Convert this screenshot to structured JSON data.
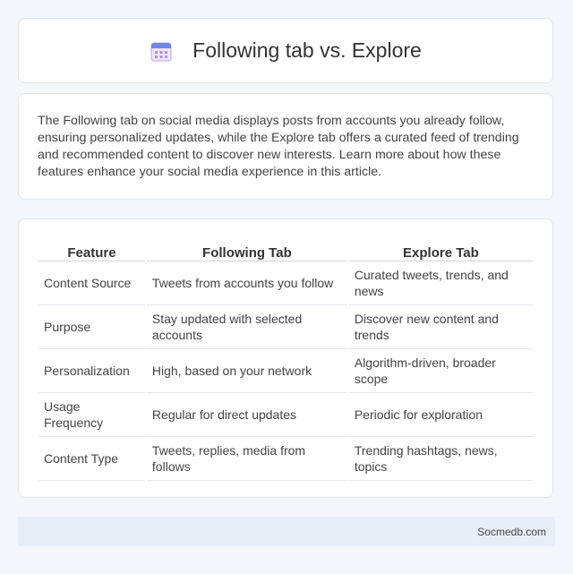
{
  "header": {
    "title": "Following tab vs. Explore",
    "icon": "calendar-icon"
  },
  "intro": {
    "text": "The Following tab on social media displays posts from accounts you already follow, ensuring personalized updates, while the Explore tab offers a curated feed of trending and recommended content to discover new interests. Learn more about how these features enhance your social media experience in this article."
  },
  "table": {
    "headers": [
      "Feature",
      "Following Tab",
      "Explore Tab"
    ],
    "rows": [
      [
        "Content Source",
        "Tweets from accounts you follow",
        "Curated tweets, trends, and news"
      ],
      [
        "Purpose",
        "Stay updated with selected accounts",
        "Discover new content and trends"
      ],
      [
        "Personalization",
        "High, based on your network",
        "Algorithm-driven, broader scope"
      ],
      [
        "Usage Frequency",
        "Regular for direct updates",
        "Periodic for exploration"
      ],
      [
        "Content Type",
        "Tweets, replies, media from follows",
        "Trending hashtags, news, topics"
      ]
    ]
  },
  "footer": {
    "site": "Socmedb.com"
  },
  "colors": {
    "accent": "#7b8fe0",
    "icon_purple": "#b28ee0"
  }
}
